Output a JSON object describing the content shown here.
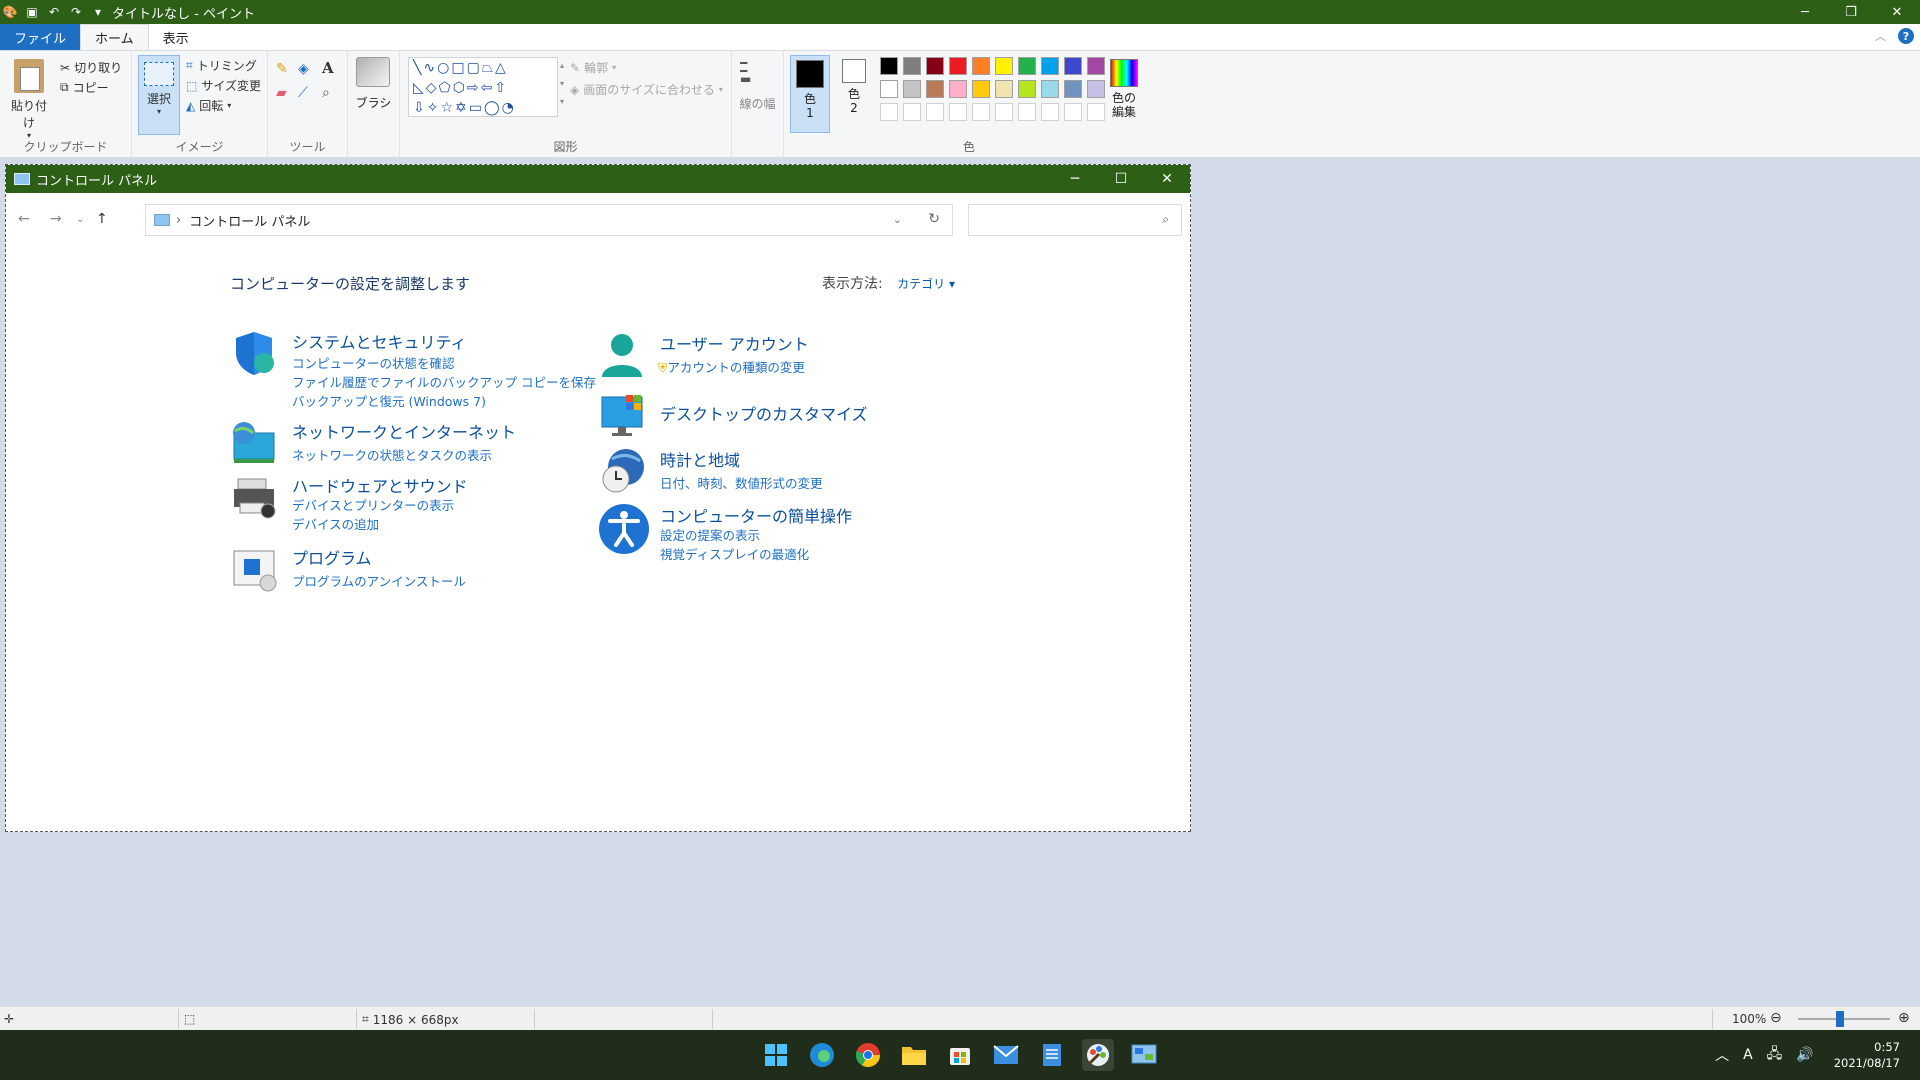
{
  "paint": {
    "window_title": "タイトルなし - ペイント",
    "tabs": [
      "ファイル",
      "ホーム",
      "表示"
    ],
    "clipboard": {
      "paste": "貼り付け",
      "cut": "切り取り",
      "copy": "コピー",
      "label": "クリップボード"
    },
    "image": {
      "select": "選択",
      "trim": "トリミング",
      "resize": "サイズ変更",
      "rotate": "回転",
      "label": "イメージ"
    },
    "tools": {
      "label": "ツール"
    },
    "brushes": {
      "label": "ブラシ"
    },
    "shapes": {
      "outline": "輪郭",
      "fill": "画面のサイズに合わせる",
      "label": "図形"
    },
    "size": {
      "label": "線の幅"
    },
    "colors": {
      "color1": "色 1",
      "color2": "色 2",
      "edit": "色の編集",
      "label": "色"
    },
    "palette_row1": [
      "#000000",
      "#7f7f7f",
      "#880015",
      "#ed1c24",
      "#ff7f27",
      "#fff200",
      "#22b14c",
      "#00a2e8",
      "#3f48cc",
      "#a349a4"
    ],
    "palette_row2": [
      "#ffffff",
      "#c3c3c3",
      "#b97a57",
      "#ffaec9",
      "#ffc90e",
      "#efe4b0",
      "#b5e61d",
      "#99d9ea",
      "#7092be",
      "#c8bfe7"
    ],
    "status": {
      "image_size": "1186 × 668px",
      "zoom": "100%"
    }
  },
  "control_panel": {
    "title": "コントロール パネル",
    "address": "コントロール パネル",
    "heading": "コンピューターの設定を調整します",
    "view_by_label": "表示方法:",
    "view_by_value": "カテゴリ",
    "categories": {
      "system": {
        "title": "システムとセキュリティ",
        "links": [
          "コンピューターの状態を確認",
          "ファイル履歴でファイルのバックアップ コピーを保存",
          "バックアップと復元 (Windows 7)"
        ]
      },
      "network": {
        "title": "ネットワークとインターネット",
        "links": [
          "ネットワークの状態とタスクの表示"
        ]
      },
      "hardware": {
        "title": "ハードウェアとサウンド",
        "links": [
          "デバイスとプリンターの表示",
          "デバイスの追加"
        ]
      },
      "programs": {
        "title": "プログラム",
        "links": [
          "プログラムのアンインストール"
        ]
      },
      "user": {
        "title": "ユーザー アカウント",
        "links": [
          "アカウントの種類の変更"
        ]
      },
      "appearance": {
        "title": "デスクトップのカスタマイズ",
        "links": []
      },
      "clock": {
        "title": "時計と地域",
        "links": [
          "日付、時刻、数値形式の変更"
        ]
      },
      "ease": {
        "title": "コンピューターの簡単操作",
        "links": [
          "設定の提案の表示",
          "視覚ディスプレイの最適化"
        ]
      }
    }
  },
  "taskbar": {
    "time": "0:57",
    "date": "2021/08/17",
    "ime": "A"
  }
}
